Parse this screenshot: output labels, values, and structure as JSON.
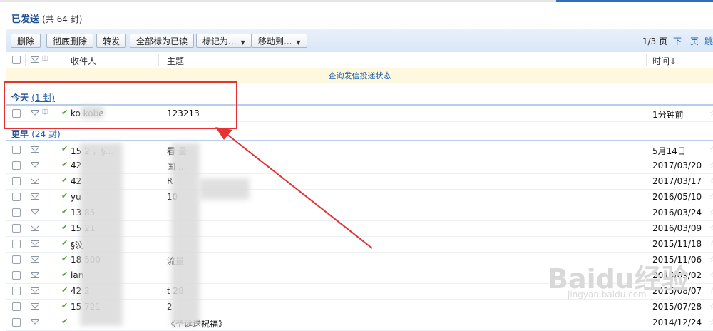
{
  "header": {
    "folder_title": "已发送",
    "count_text": "(共 64 封)"
  },
  "toolbar": {
    "buttons": [
      "删除",
      "彻底删除",
      "转发",
      "全部标为已读",
      "标记为...",
      "移动到..."
    ],
    "page_info": "1/3 页",
    "next_page": "下一页",
    "jump": "跳"
  },
  "columns": {
    "recipient": "收件人",
    "subject": "主题",
    "time": "时间↓"
  },
  "notice": "查询发信投递状态",
  "groups": {
    "today": {
      "label": "今天",
      "count": "(1 封)"
    },
    "earlier": {
      "label": "更早",
      "count": "(24 封)"
    }
  },
  "rows_today": [
    {
      "recipient": "ko   kobe",
      "subject": "123213",
      "time": "1分钟前"
    }
  ],
  "rows_earlier": [
    {
      "recipient": "15   2 ，§...",
      "subject": "看   量",
      "time": "5月14日"
    },
    {
      "recipient": "42",
      "subject": "国   ...",
      "time": "2017/03/20"
    },
    {
      "recipient": "42",
      "subject": "R",
      "time": "2017/03/17"
    },
    {
      "recipient": "yu",
      "subject": "10",
      "time": "2016/05/10"
    },
    {
      "recipient": "13   85",
      "subject": "",
      "time": "2016/03/24"
    },
    {
      "recipient": "15   21",
      "subject": "",
      "time": "2016/03/09"
    },
    {
      "recipient": "§汶",
      "subject": "",
      "time": "2015/11/18"
    },
    {
      "recipient": "18   500",
      "subject": "流量",
      "time": "2015/11/06"
    },
    {
      "recipient": "ian",
      "subject": "",
      "time": "2015/09/02"
    },
    {
      "recipient": "42   2",
      "subject": "t   28",
      "time": "2015/08/07"
    },
    {
      "recipient": "15   721",
      "subject": "2",
      "time": "2015/07/28"
    },
    {
      "recipient": "",
      "subject": "《圣诞送祝福》",
      "time": "2014/12/24"
    }
  ],
  "watermark": {
    "brand": "Baidu经验",
    "url": "jingyan.baidu.com"
  },
  "colors": {
    "accent_blue": "#1b4f96",
    "highlight_red": "#e53333",
    "toolbar_bg": "#dfeaf7"
  }
}
